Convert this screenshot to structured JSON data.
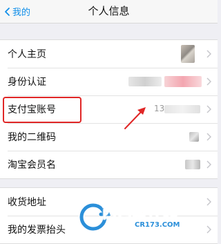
{
  "nav": {
    "back_label": "我的",
    "title": "个人信息"
  },
  "group1": {
    "rows": [
      {
        "label": "个人主页"
      },
      {
        "label": "身份认证"
      },
      {
        "label": "支付宝账号",
        "value": "13"
      },
      {
        "label": "我的二维码"
      },
      {
        "label": "淘宝会员名"
      }
    ]
  },
  "group2": {
    "rows": [
      {
        "label": "收货地址"
      },
      {
        "label": "我的发票抬头"
      }
    ]
  },
  "watermark": {
    "brand": "西西软件园",
    "domain": "CR173.COM"
  },
  "colors": {
    "accent": "#108ee9",
    "highlight": "#e02626",
    "background": "#efeff4"
  },
  "icons": [
    "chevron-left-icon",
    "chevron-right-icon",
    "arrow-annotation-icon"
  ]
}
